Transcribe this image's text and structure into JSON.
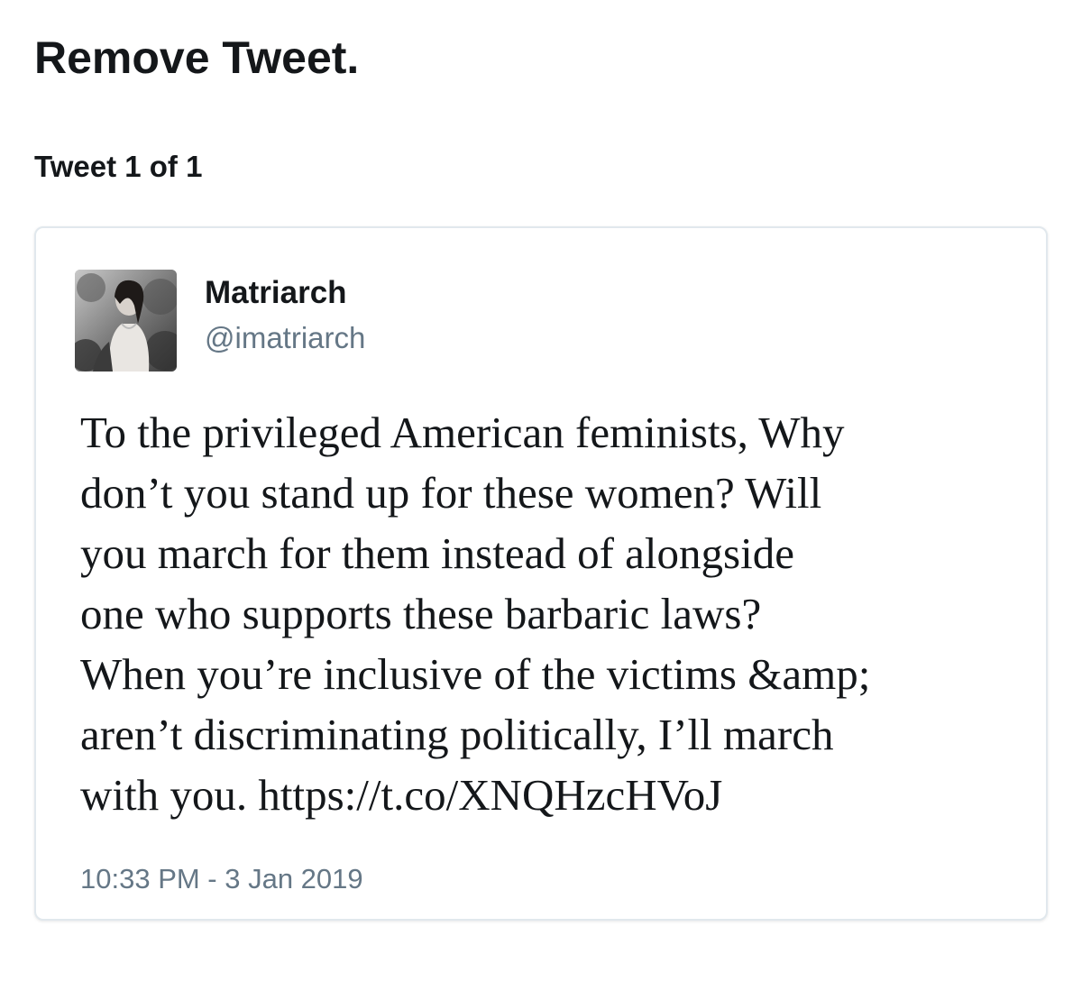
{
  "page": {
    "heading": "Remove Tweet.",
    "tweet_count": "Tweet 1 of 1"
  },
  "tweet": {
    "author": {
      "name": "Matriarch",
      "handle": "@imatriarch",
      "avatar_icon": "profile-photo"
    },
    "text_lines": [
      "To the privileged American feminists, Why",
      "don’t you stand up for these women? Will",
      "you march for them instead of alongside",
      "one who supports these barbaric laws?",
      "When you’re inclusive of the victims &amp;",
      "aren’t discriminating politically, I’ll march",
      "with you. https://t.co/XNQHzcHVoJ"
    ],
    "timestamp": "10:33 PM - 3 Jan 2019"
  },
  "colors": {
    "text_primary": "#14171a",
    "text_secondary": "#657786",
    "card_border": "#e1e8ed",
    "background": "#ffffff"
  }
}
